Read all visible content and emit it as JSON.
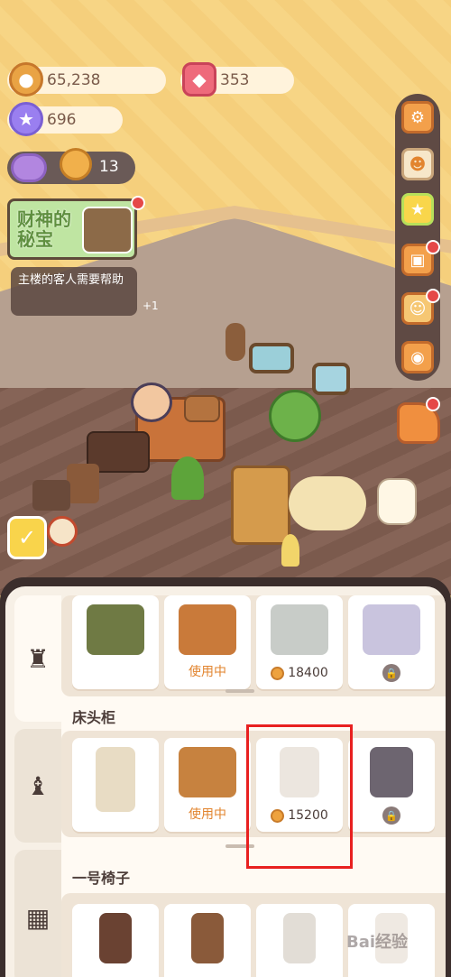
{
  "resources": {
    "coins": "65,238",
    "gems": "353",
    "stars": "696",
    "lions": "13"
  },
  "event": {
    "title": "财神的秘宝"
  },
  "quest": {
    "text": "主楼的客人需要帮助",
    "badge": "+1"
  },
  "shop": {
    "sections": [
      {
        "title": "",
        "items": [
          {
            "status": "",
            "price": ""
          },
          {
            "status": "使用中",
            "price": ""
          },
          {
            "status": "",
            "price": "18400"
          },
          {
            "status": "locked",
            "price": ""
          }
        ]
      },
      {
        "title": "床头柜",
        "items": [
          {
            "status": "",
            "price": ""
          },
          {
            "status": "使用中",
            "price": ""
          },
          {
            "status": "",
            "price": "15200"
          },
          {
            "status": "locked",
            "price": ""
          }
        ]
      },
      {
        "title": "一号椅子",
        "items": []
      }
    ]
  },
  "watermark": "Bai经验",
  "colors": {
    "accent_orange": "#e2842e",
    "highlight_red": "#e82020"
  },
  "icons": {
    "coin": "coin-icon",
    "gem": "gem-icon",
    "star": "star-icon",
    "settings": "gear-icon",
    "lock": "lock-icon"
  }
}
